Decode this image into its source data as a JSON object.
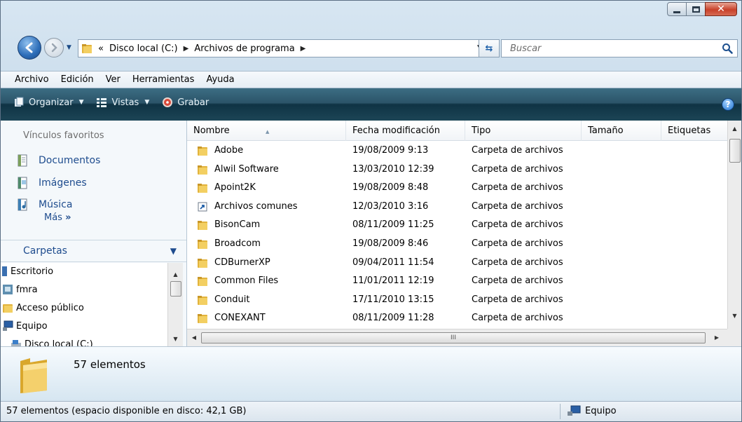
{
  "address": {
    "overflow": "«",
    "crumbs": [
      "Disco local (C:)",
      "Archivos de programa"
    ]
  },
  "search": {
    "placeholder": "Buscar"
  },
  "menu": [
    "Archivo",
    "Edición",
    "Ver",
    "Herramientas",
    "Ayuda"
  ],
  "toolbar": {
    "organize": "Organizar",
    "views": "Vistas",
    "burn": "Grabar"
  },
  "favorites": {
    "title": "Vínculos favoritos",
    "links": [
      "Documentos",
      "Imágenes",
      "Música"
    ],
    "more": "Más",
    "more_chevron": "»"
  },
  "folders": {
    "title": "Carpetas",
    "tree": [
      "Escritorio",
      "fmra",
      "Acceso público",
      "Equipo",
      "Disco local (C:)"
    ]
  },
  "columns": {
    "name": "Nombre",
    "date": "Fecha modificación",
    "type": "Tipo",
    "size": "Tamaño",
    "tags": "Etiquetas"
  },
  "files": [
    {
      "name": "Adobe",
      "date": "19/08/2009 9:13",
      "type": "Carpeta de archivos",
      "icon": "folder-icon"
    },
    {
      "name": "Alwil Software",
      "date": "13/03/2010 12:39",
      "type": "Carpeta de archivos",
      "icon": "folder-icon"
    },
    {
      "name": "Apoint2K",
      "date": "19/08/2009 8:48",
      "type": "Carpeta de archivos",
      "icon": "folder-icon"
    },
    {
      "name": "Archivos comunes",
      "date": "12/03/2010 3:16",
      "type": "Carpeta de archivos",
      "icon": "shortcut-icon"
    },
    {
      "name": "BisonCam",
      "date": "08/11/2009 11:25",
      "type": "Carpeta de archivos",
      "icon": "folder-icon"
    },
    {
      "name": "Broadcom",
      "date": "19/08/2009 8:46",
      "type": "Carpeta de archivos",
      "icon": "folder-icon"
    },
    {
      "name": "CDBurnerXP",
      "date": "09/04/2011 11:54",
      "type": "Carpeta de archivos",
      "icon": "folder-icon"
    },
    {
      "name": "Common Files",
      "date": "11/01/2011 12:19",
      "type": "Carpeta de archivos",
      "icon": "folder-icon"
    },
    {
      "name": "Conduit",
      "date": "17/11/2010 13:15",
      "type": "Carpeta de archivos",
      "icon": "folder-icon"
    },
    {
      "name": "CONEXANT",
      "date": "08/11/2009 11:28",
      "type": "Carpeta de archivos",
      "icon": "folder-icon"
    }
  ],
  "scroll_grip": "III",
  "details": {
    "count": "57 elementos"
  },
  "status": {
    "text": "57 elementos (espacio disponible en disco: 42,1 GB)",
    "location": "Equipo"
  },
  "colors": {
    "accent_link": "#1e4c8e",
    "command_bar": "#1c4556",
    "close_button": "#c8412a"
  }
}
